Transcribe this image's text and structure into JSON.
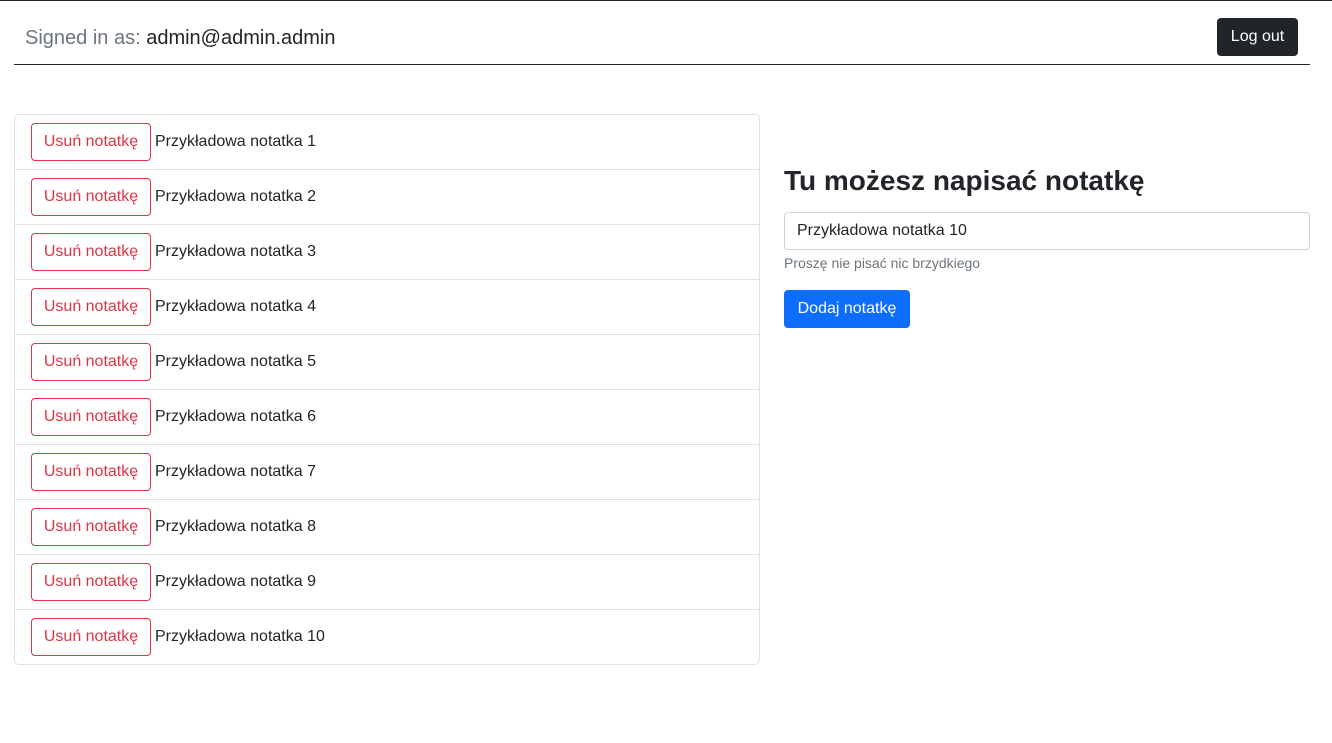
{
  "navbar": {
    "signed_in_label": "Signed in as:",
    "user_email": "admin@admin.admin",
    "logout_label": "Log out"
  },
  "notes": {
    "delete_label": "Usuń notatkę",
    "items": [
      {
        "text": "Przykładowa notatka 1"
      },
      {
        "text": "Przykładowa notatka 2"
      },
      {
        "text": "Przykładowa notatka 3"
      },
      {
        "text": "Przykładowa notatka 4"
      },
      {
        "text": "Przykładowa notatka 5"
      },
      {
        "text": "Przykładowa notatka 6"
      },
      {
        "text": "Przykładowa notatka 7"
      },
      {
        "text": "Przykładowa notatka 8"
      },
      {
        "text": "Przykładowa notatka 9"
      },
      {
        "text": "Przykładowa notatka 10"
      }
    ]
  },
  "form": {
    "title": "Tu możesz napisać notatkę",
    "input_value": "Przykładowa notatka 10",
    "help_text": "Proszę nie pisać nic brzydkiego",
    "submit_label": "Dodaj notatkę"
  },
  "colors": {
    "primary": "#0d6efd",
    "danger": "#dc3545",
    "dark": "#212529",
    "muted": "#6c757d",
    "border": "#dee2e6"
  }
}
